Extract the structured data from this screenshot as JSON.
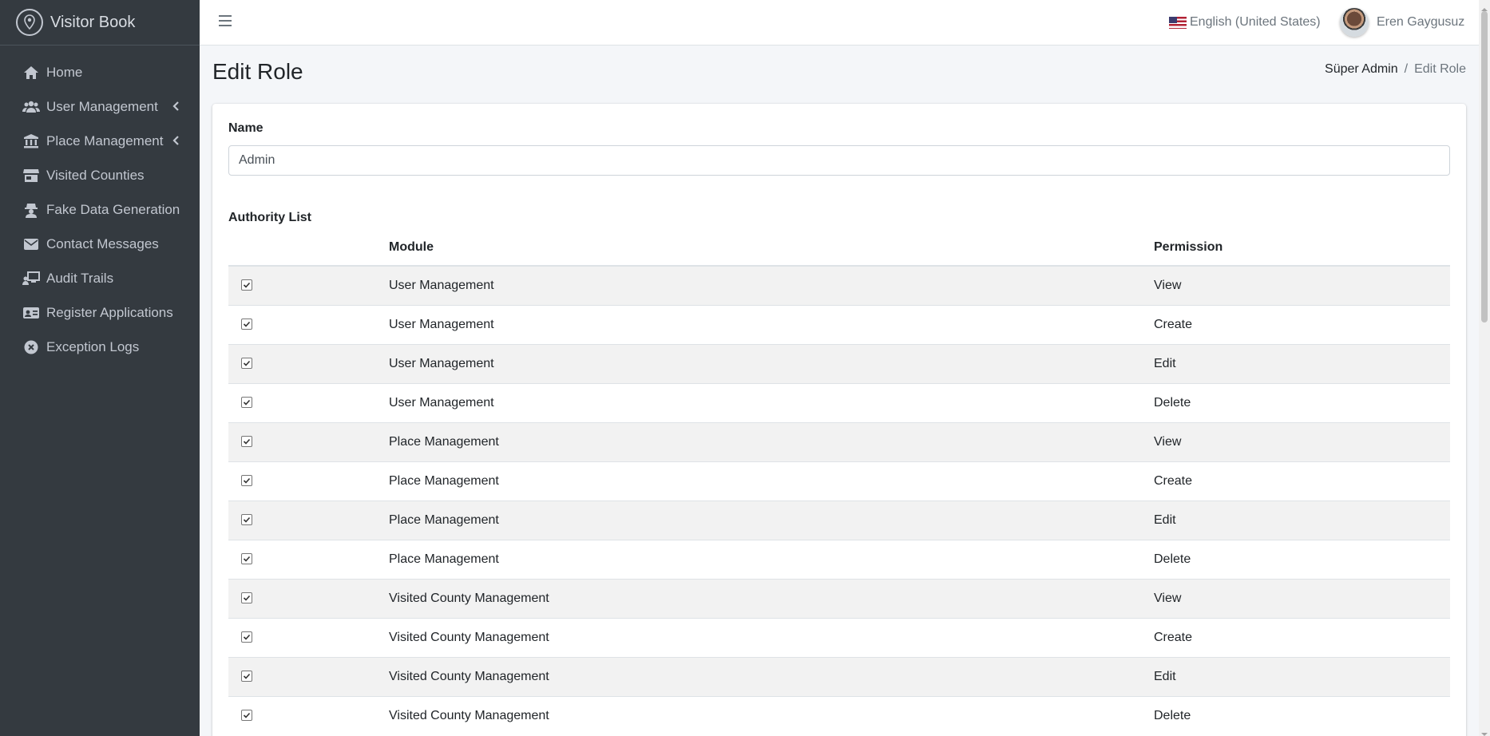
{
  "brand": {
    "name": "Visitor Book",
    "icon": "map-pin-logo-icon"
  },
  "sidebar": {
    "items": [
      {
        "label": "Home",
        "icon": "home-icon",
        "has_caret": false
      },
      {
        "label": "User Management",
        "icon": "users-icon",
        "has_caret": true
      },
      {
        "label": "Place Management",
        "icon": "landmark-icon",
        "has_caret": true
      },
      {
        "label": "Visited Counties",
        "icon": "store-icon",
        "has_caret": false
      },
      {
        "label": "Fake Data Generation",
        "icon": "user-secret-icon",
        "has_caret": false
      },
      {
        "label": "Contact Messages",
        "icon": "envelope-icon",
        "has_caret": false
      },
      {
        "label": "Audit Trails",
        "icon": "chalkboard-user-icon",
        "has_caret": false
      },
      {
        "label": "Register Applications",
        "icon": "id-card-icon",
        "has_caret": false
      },
      {
        "label": "Exception Logs",
        "icon": "circle-xmark-icon",
        "has_caret": false
      }
    ]
  },
  "topbar": {
    "language": "English (United States)",
    "user_name": "Eren Gaygusuz"
  },
  "page": {
    "title": "Edit Role",
    "breadcrumb": {
      "parent": "Süper Admin",
      "separator": "/",
      "current": "Edit Role"
    }
  },
  "form": {
    "name_label": "Name",
    "name_value": "Admin",
    "authority_label": "Authority List",
    "columns": {
      "module": "Module",
      "permission": "Permission"
    },
    "rows": [
      {
        "checked": true,
        "module": "User Management",
        "permission": "View"
      },
      {
        "checked": true,
        "module": "User Management",
        "permission": "Create"
      },
      {
        "checked": true,
        "module": "User Management",
        "permission": "Edit"
      },
      {
        "checked": true,
        "module": "User Management",
        "permission": "Delete"
      },
      {
        "checked": true,
        "module": "Place Management",
        "permission": "View"
      },
      {
        "checked": true,
        "module": "Place Management",
        "permission": "Create"
      },
      {
        "checked": true,
        "module": "Place Management",
        "permission": "Edit"
      },
      {
        "checked": true,
        "module": "Place Management",
        "permission": "Delete"
      },
      {
        "checked": true,
        "module": "Visited County Management",
        "permission": "View"
      },
      {
        "checked": true,
        "module": "Visited County Management",
        "permission": "Create"
      },
      {
        "checked": true,
        "module": "Visited County Management",
        "permission": "Edit"
      },
      {
        "checked": true,
        "module": "Visited County Management",
        "permission": "Delete"
      }
    ]
  },
  "colors": {
    "sidebar_bg": "#343a40",
    "sidebar_text": "#c2c7d0",
    "content_bg": "#f4f6f9",
    "striped_row": "#f2f2f2"
  }
}
